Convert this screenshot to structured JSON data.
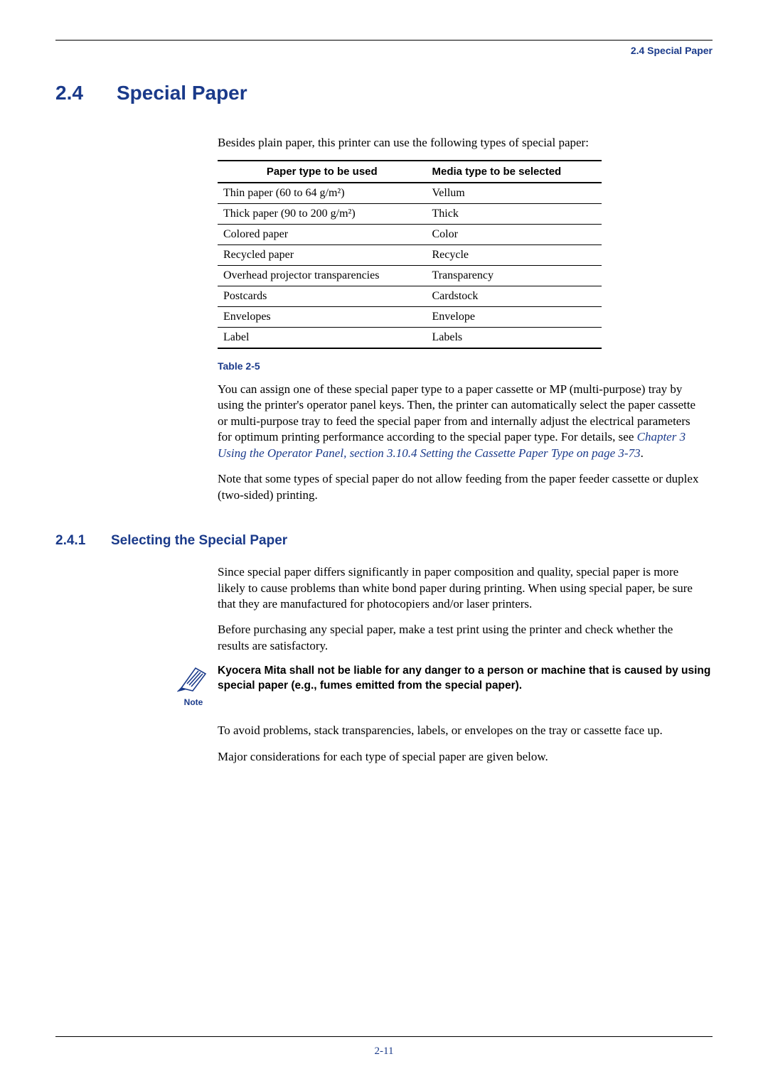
{
  "header": {
    "running": "2.4 Special Paper"
  },
  "title": {
    "num": "2.4",
    "text": "Special Paper"
  },
  "intro": "Besides plain paper, this printer can use the following types of special paper:",
  "chart_data": {
    "type": "table",
    "title": "Table 2-5",
    "columns": [
      "Paper type to be used",
      "Media type to be selected"
    ],
    "rows": [
      [
        "Thin paper (60 to 64 g/m²)",
        "Vellum"
      ],
      [
        "Thick paper (90 to 200 g/m²)",
        "Thick"
      ],
      [
        "Colored paper",
        "Color"
      ],
      [
        "Recycled paper",
        "Recycle"
      ],
      [
        "Overhead projector transparencies",
        "Transparency"
      ],
      [
        "Postcards",
        "Cardstock"
      ],
      [
        "Envelopes",
        "Envelope"
      ],
      [
        "Label",
        "Labels"
      ]
    ]
  },
  "table_caption": "Table 2-5",
  "para1a": "You can assign one of these special paper type to a paper cassette or MP (multi-purpose) tray by using the printer's operator panel keys. Then, the printer can automatically select the paper cassette or multi-purpose tray to feed the special paper from and internally adjust the electrical parameters for optimum printing performance according to the special paper type. For details, see ",
  "para1_link": "Chapter 3 Using the Operator Panel, section 3.10.4 Setting the Cassette Paper Type on page 3-73",
  "para1b": ".",
  "para2": "Note that some types of special paper do not allow feeding from the paper feeder cassette or duplex (two-sided) printing.",
  "subsection": {
    "num": "2.4.1",
    "text": "Selecting the Special Paper"
  },
  "para3": "Since special paper differs significantly in paper composition and quality, special paper is more likely to cause problems than white bond paper during printing. When using special paper, be sure that they are manufactured for photocopiers and/or laser printers.",
  "para4": "Before purchasing any special paper, make a test print using the printer and check whether the results are satisfactory.",
  "note": {
    "label": "Note",
    "text": "Kyocera Mita shall not be liable for any danger to a person or machine that is caused by using special paper (e.g., fumes emitted from the special paper)."
  },
  "para5": "To avoid problems, stack transparencies, labels, or envelopes on the tray or cassette face up.",
  "para6": "Major considerations for each type of special paper are given below.",
  "footer": {
    "page": "2-11"
  }
}
